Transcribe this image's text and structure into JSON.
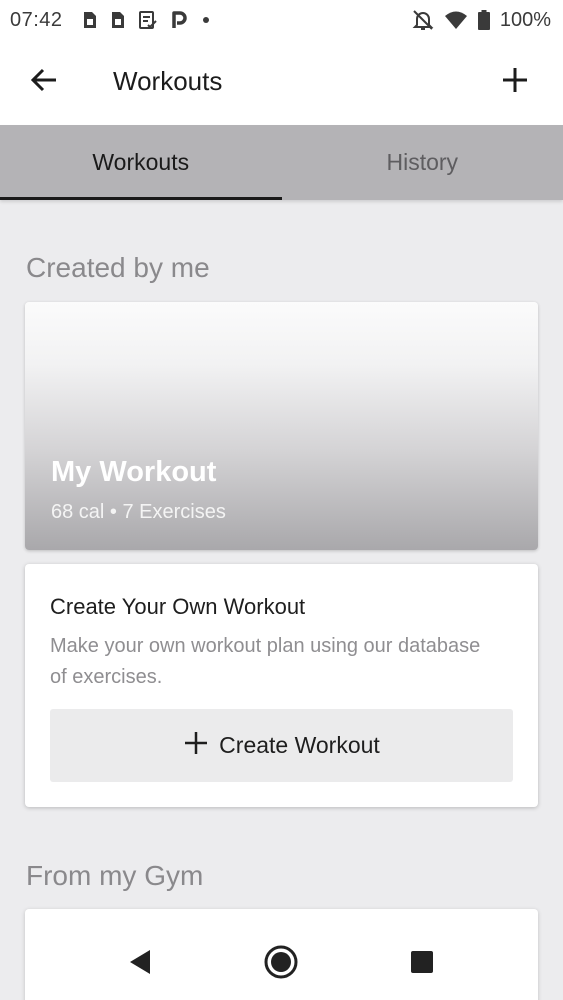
{
  "status_bar": {
    "time": "07:42",
    "battery": "100%",
    "left_icons": [
      "sim-card-icon",
      "sim-card-icon",
      "checklist-icon",
      "parking-icon",
      "dot-icon"
    ],
    "right_icons": [
      "bell-off-icon",
      "wifi-icon",
      "battery-icon"
    ]
  },
  "app_bar": {
    "title": "Workouts",
    "back_icon": "arrow-left-icon",
    "add_icon": "plus-icon"
  },
  "tabs": [
    {
      "label": "Workouts",
      "active": true
    },
    {
      "label": "History",
      "active": false
    }
  ],
  "sections": {
    "created_by_me": "Created by me",
    "from_my_gym": "From my Gym"
  },
  "featured_workout": {
    "name": "My Workout",
    "meta": "68 cal • 7 Exercises"
  },
  "create_card": {
    "title": "Create Your Own Workout",
    "description": "Make your own workout plan using our database of exercises.",
    "button_label": "Create Workout",
    "button_icon": "plus-icon"
  },
  "nav_bar": {
    "icons": [
      "back-triangle-icon",
      "home-circle-icon",
      "recents-square-icon"
    ]
  },
  "colors": {
    "tab_bar": "#b4b3b6",
    "background": "#ececee",
    "section_title": "#8a898c"
  }
}
